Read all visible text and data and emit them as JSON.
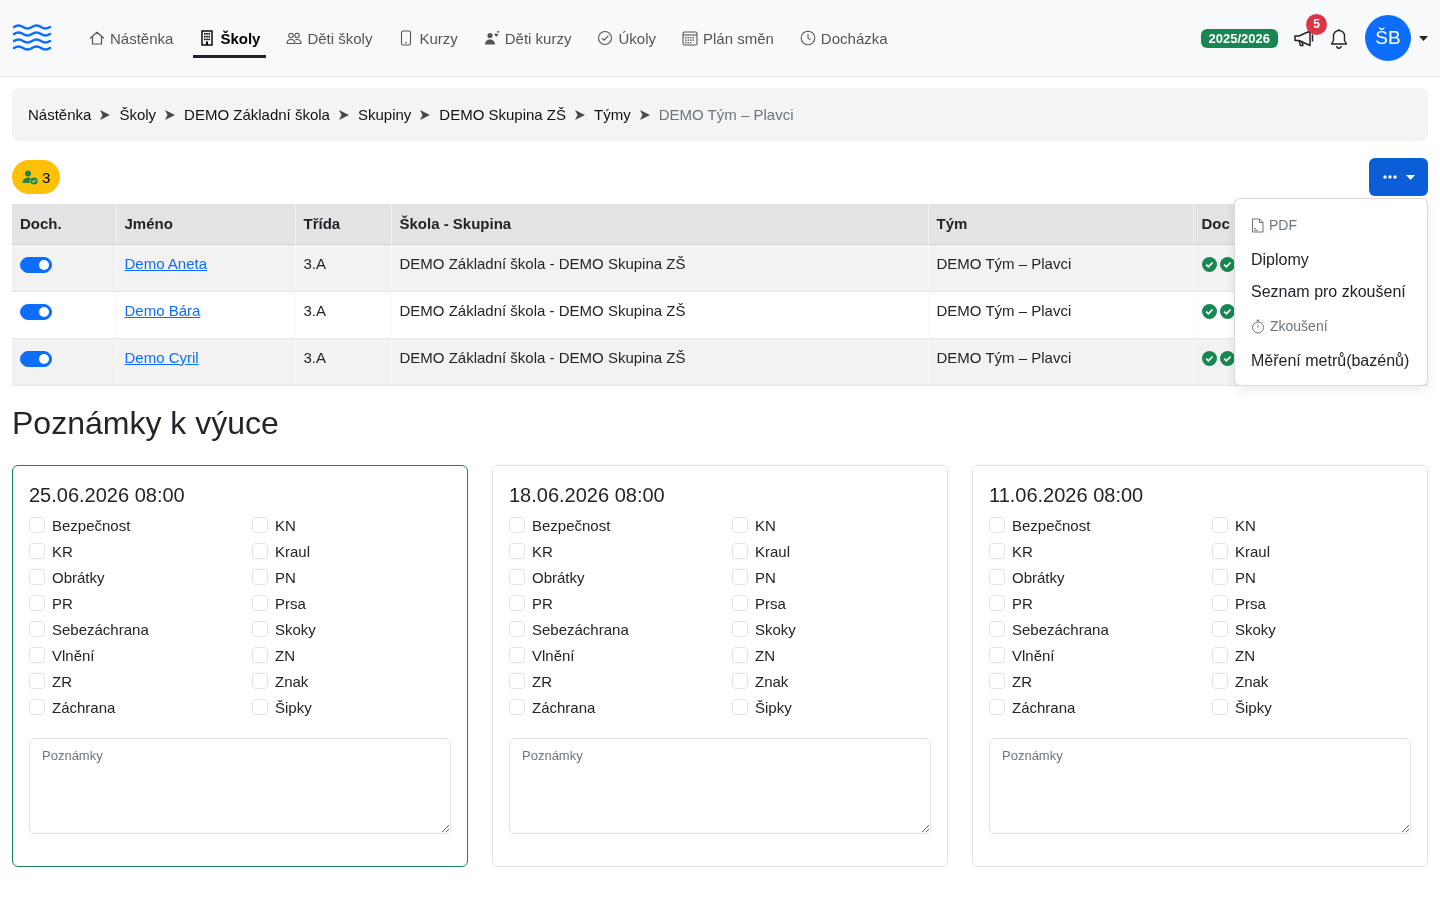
{
  "nav": {
    "items": [
      {
        "label": "Nástěnka",
        "selected": false
      },
      {
        "label": "Školy",
        "selected": true
      },
      {
        "label": "Děti školy",
        "selected": false
      },
      {
        "label": "Kurzy",
        "selected": false
      },
      {
        "label": "Děti kurzy",
        "selected": false
      },
      {
        "label": "Úkoly",
        "selected": false
      },
      {
        "label": "Plán směn",
        "selected": false
      },
      {
        "label": "Docházka",
        "selected": false
      }
    ],
    "season": "2025/2026",
    "announcements_count": "5",
    "avatar_initials": "ŠB"
  },
  "breadcrumb": [
    {
      "label": "Nástěnka",
      "current": false
    },
    {
      "label": "Školy",
      "current": false
    },
    {
      "label": "DEMO Základní škola",
      "current": false
    },
    {
      "label": "Skupiny",
      "current": false
    },
    {
      "label": "DEMO Skupina ZŠ",
      "current": false
    },
    {
      "label": "Týmy",
      "current": false
    },
    {
      "label": "DEMO Tým – Plavci",
      "current": true
    }
  ],
  "toolbar": {
    "member_count": "3",
    "actions_menu": {
      "expanded": true,
      "items": [
        {
          "kind": "header",
          "label": "PDF"
        },
        {
          "kind": "item",
          "label": "Diplomy"
        },
        {
          "kind": "item",
          "label": "Seznam pro zkoušení"
        },
        {
          "kind": "header",
          "label": "Zkoušení"
        },
        {
          "kind": "item",
          "label": "Měření metrů(bazénů)"
        }
      ]
    }
  },
  "table": {
    "columns": [
      "Doch.",
      "Jméno",
      "Třída",
      "Škola - Skupina",
      "Tým",
      "Doc"
    ],
    "rows": [
      {
        "attendance": true,
        "name": "Demo Aneta",
        "class": "3.A",
        "school_group": "DEMO Základní škola - DEMO Skupina ZŠ",
        "team": "DEMO Tým – Plavci",
        "marks": [
          {
            "kind": "done"
          },
          {
            "kind": "done"
          }
        ]
      },
      {
        "attendance": true,
        "name": "Demo Bára",
        "class": "3.A",
        "school_group": "DEMO Základní škola - DEMO Skupina ZŠ",
        "team": "DEMO Tým – Plavci",
        "marks": [
          {
            "kind": "done"
          },
          {
            "kind": "done"
          }
        ]
      },
      {
        "attendance": true,
        "name": "Demo Cyril",
        "class": "3.A",
        "school_group": "DEMO Základní škola - DEMO Skupina ZŠ",
        "team": "DEMO Tým – Plavci",
        "marks": [
          {
            "kind": "done"
          },
          {
            "kind": "done"
          }
        ]
      }
    ]
  },
  "notes": {
    "title": "Poznámky k výuce",
    "cards": [
      {
        "date": "25.06.2026 08:00",
        "highlighted": true,
        "skills": [
          {
            "label": "Bezpečnost",
            "checked": false
          },
          {
            "label": "KN",
            "checked": false
          },
          {
            "label": "KR",
            "checked": false
          },
          {
            "label": "Kraul",
            "checked": false
          },
          {
            "label": "Obrátky",
            "checked": false
          },
          {
            "label": "PN",
            "checked": false
          },
          {
            "label": "PR",
            "checked": false
          },
          {
            "label": "Prsa",
            "checked": false
          },
          {
            "label": "Sebezáchrana",
            "checked": false
          },
          {
            "label": "Skoky",
            "checked": false
          },
          {
            "label": "Vlnění",
            "checked": false
          },
          {
            "label": "ZN",
            "checked": false
          },
          {
            "label": "ZR",
            "checked": false
          },
          {
            "label": "Znak",
            "checked": false
          },
          {
            "label": "Záchrana",
            "checked": false
          },
          {
            "label": "Šipky",
            "checked": false
          }
        ],
        "notes_field": {
          "placeholder": "Poznámky"
        }
      },
      {
        "date": "18.06.2026 08:00",
        "highlighted": false,
        "skills": [
          {
            "label": "Bezpečnost",
            "checked": false
          },
          {
            "label": "KN",
            "checked": false
          },
          {
            "label": "KR",
            "checked": false
          },
          {
            "label": "Kraul",
            "checked": false
          },
          {
            "label": "Obrátky",
            "checked": false
          },
          {
            "label": "PN",
            "checked": false
          },
          {
            "label": "PR",
            "checked": false
          },
          {
            "label": "Prsa",
            "checked": false
          },
          {
            "label": "Sebezáchrana",
            "checked": false
          },
          {
            "label": "Skoky",
            "checked": false
          },
          {
            "label": "Vlnění",
            "checked": false
          },
          {
            "label": "ZN",
            "checked": false
          },
          {
            "label": "ZR",
            "checked": false
          },
          {
            "label": "Znak",
            "checked": false
          },
          {
            "label": "Záchrana",
            "checked": false
          },
          {
            "label": "Šipky",
            "checked": false
          }
        ],
        "notes_field": {
          "placeholder": "Poznámky"
        }
      },
      {
        "date": "11.06.2026 08:00",
        "highlighted": false,
        "skills": [
          {
            "label": "Bezpečnost",
            "checked": false
          },
          {
            "label": "KN",
            "checked": false
          },
          {
            "label": "KR",
            "checked": false
          },
          {
            "label": "Kraul",
            "checked": false
          },
          {
            "label": "Obrátky",
            "checked": false
          },
          {
            "label": "PN",
            "checked": false
          },
          {
            "label": "PR",
            "checked": false
          },
          {
            "label": "Prsa",
            "checked": false
          },
          {
            "label": "Sebezáchrana",
            "checked": false
          },
          {
            "label": "Skoky",
            "checked": false
          },
          {
            "label": "Vlnění",
            "checked": false
          },
          {
            "label": "ZN",
            "checked": false
          },
          {
            "label": "ZR",
            "checked": false
          },
          {
            "label": "Znak",
            "checked": false
          },
          {
            "label": "Záchrana",
            "checked": false
          },
          {
            "label": "Šipky",
            "checked": false
          }
        ],
        "notes_field": {
          "placeholder": "Poznámky"
        }
      }
    ]
  }
}
